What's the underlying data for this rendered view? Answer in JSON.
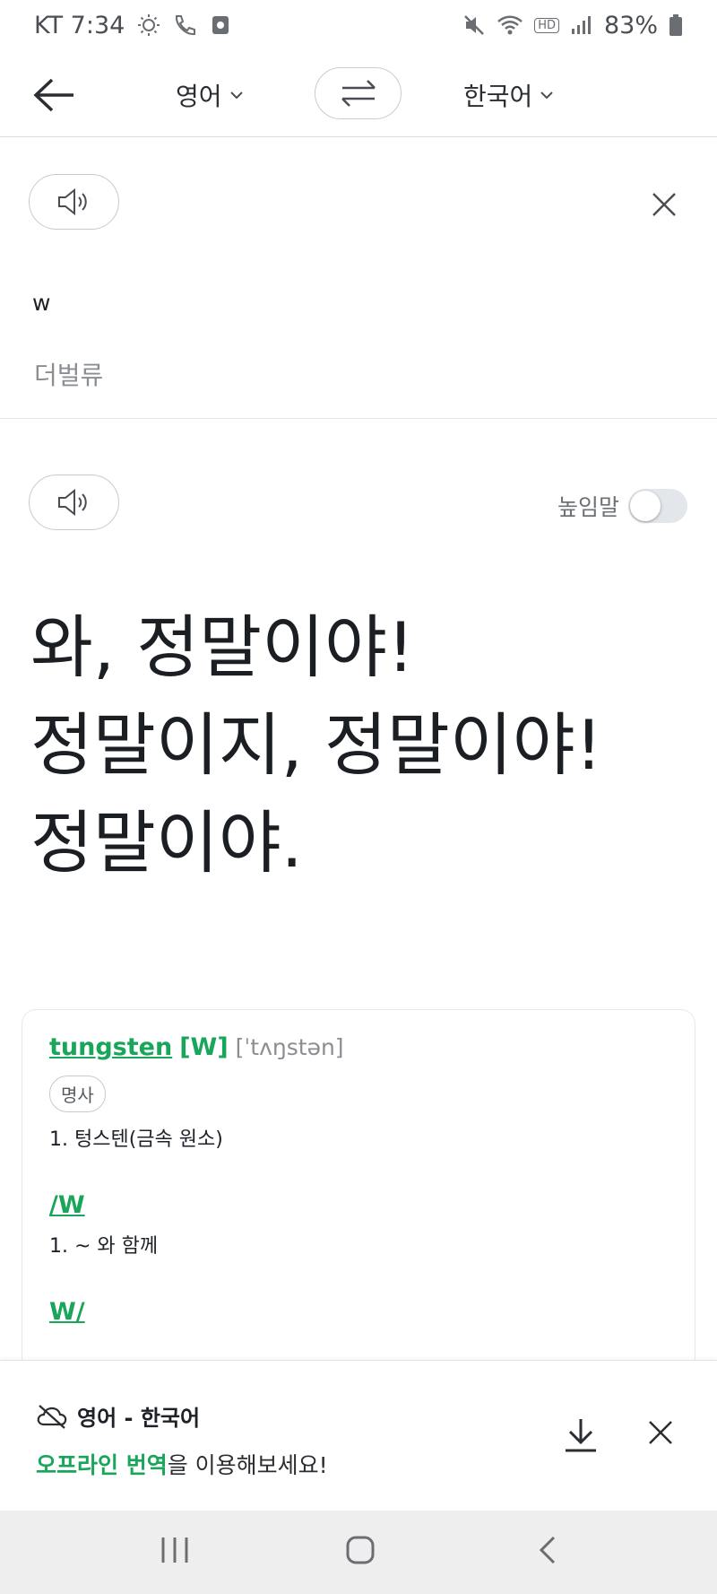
{
  "status_bar": {
    "carrier_time": "KT 7:34",
    "battery": "83%",
    "hd_label": "HD"
  },
  "header": {
    "source_language": "영어",
    "target_language": "한국어"
  },
  "source": {
    "text": "w",
    "pronunciation": "더벌류"
  },
  "result": {
    "honorific_label": "높임말",
    "honorific_on": false,
    "lines": [
      "와, 정말이야!",
      "정말이지, 정말이야!",
      "정말이야."
    ]
  },
  "dictionary": {
    "word": "tungsten",
    "abbr": "[W]",
    "ipa": "[ˈtʌŋstən]",
    "pos": "명사",
    "definition": "1. 텅스텐(금속 원소)",
    "entry2_word": "/W",
    "entry2_def": "1. ~ 와 함께",
    "entry3_word": "W/"
  },
  "offline": {
    "title": "영어 - 한국어",
    "highlight": "오프라인 번역",
    "message_rest": "을 이용해보세요!"
  },
  "colors": {
    "accent_green": "#19a55a",
    "text_dark": "#1e2228",
    "text_gray": "#8a8e93"
  }
}
